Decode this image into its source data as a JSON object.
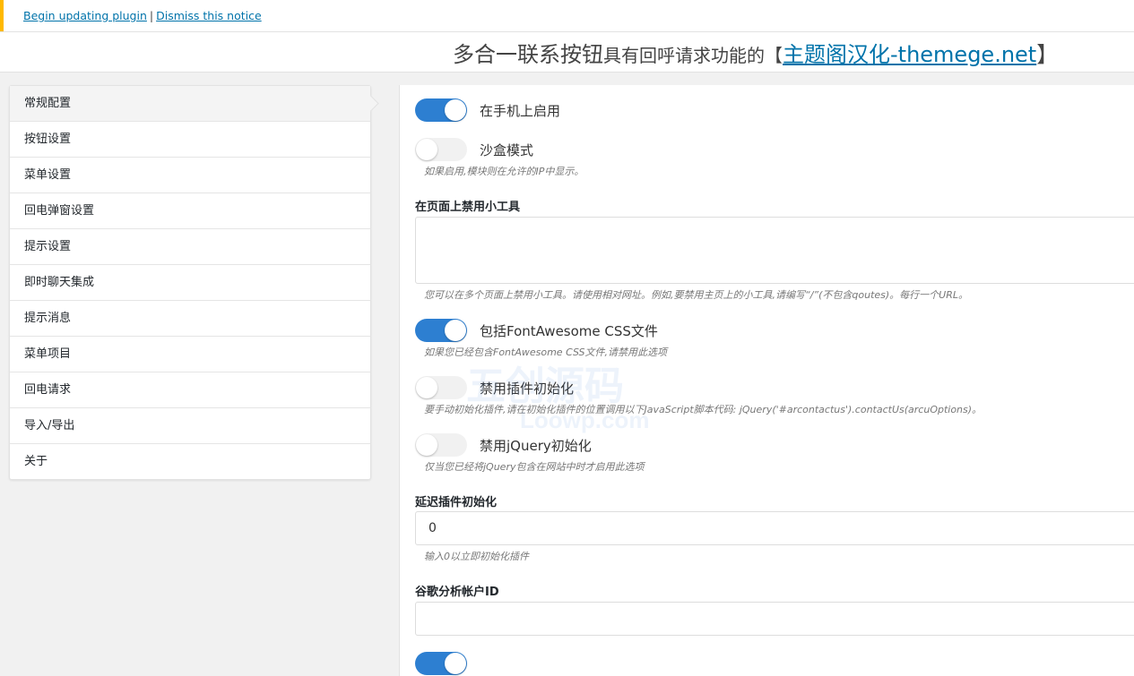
{
  "notice": {
    "begin_link": "Begin updating plugin",
    "separator": "|",
    "dismiss_link": "Dismiss this notice"
  },
  "header": {
    "title_prefix": "多合一联系按钮",
    "title_mid": "具有回呼请求功能的【",
    "title_link": "主题阁汉化-themege.net",
    "title_suffix": "】"
  },
  "sidebar": {
    "items": [
      {
        "label": "常规配置"
      },
      {
        "label": "按钮设置"
      },
      {
        "label": "菜单设置"
      },
      {
        "label": "回电弹窗设置"
      },
      {
        "label": "提示设置"
      },
      {
        "label": "即时聊天集成"
      },
      {
        "label": "提示消息"
      },
      {
        "label": "菜单项目"
      },
      {
        "label": "回电请求"
      },
      {
        "label": "导入/导出"
      },
      {
        "label": "关于"
      }
    ],
    "active_index": 0
  },
  "settings": {
    "enable_mobile": {
      "label": "在手机上启用",
      "state": "on"
    },
    "sandbox": {
      "label": "沙盒模式",
      "state": "off",
      "desc": "如果启用,模块则在允许的IP中显示。"
    },
    "disable_pages": {
      "label": "在页面上禁用小工具",
      "value": "",
      "desc": "您可以在多个页面上禁用小工具。请使用相对网址。例如,要禁用主页上的小工具,请编写“/”(不包含qoutes)。每行一个URL。"
    },
    "fontawesome": {
      "label": "包括FontAwesome CSS文件",
      "state": "on",
      "desc": "如果您已经包含FontAwesome CSS文件,请禁用此选项"
    },
    "disable_init": {
      "label": "禁用插件初始化",
      "state": "off",
      "desc": "要手动初始化插件,请在初始化插件的位置调用以下JavaScript脚本代码:  jQuery('#arcontactus').contactUs(arcuOptions)。"
    },
    "disable_jquery": {
      "label": "禁用jQuery初始化",
      "state": "off",
      "desc": "仅当您已经将jQuery包含在网站中时才启用此选项"
    },
    "delay_init": {
      "label": "延迟插件初始化",
      "value": "0",
      "desc": "输入0以立即初始化插件"
    },
    "ga_account": {
      "label": "谷歌分析帐户ID",
      "value": ""
    }
  },
  "watermark": {
    "main": "五创源码",
    "sub": "Loowp.com"
  },
  "colors": {
    "accent": "#2d7fd1",
    "notice_border": "#ffb900",
    "link": "#0073aa"
  }
}
